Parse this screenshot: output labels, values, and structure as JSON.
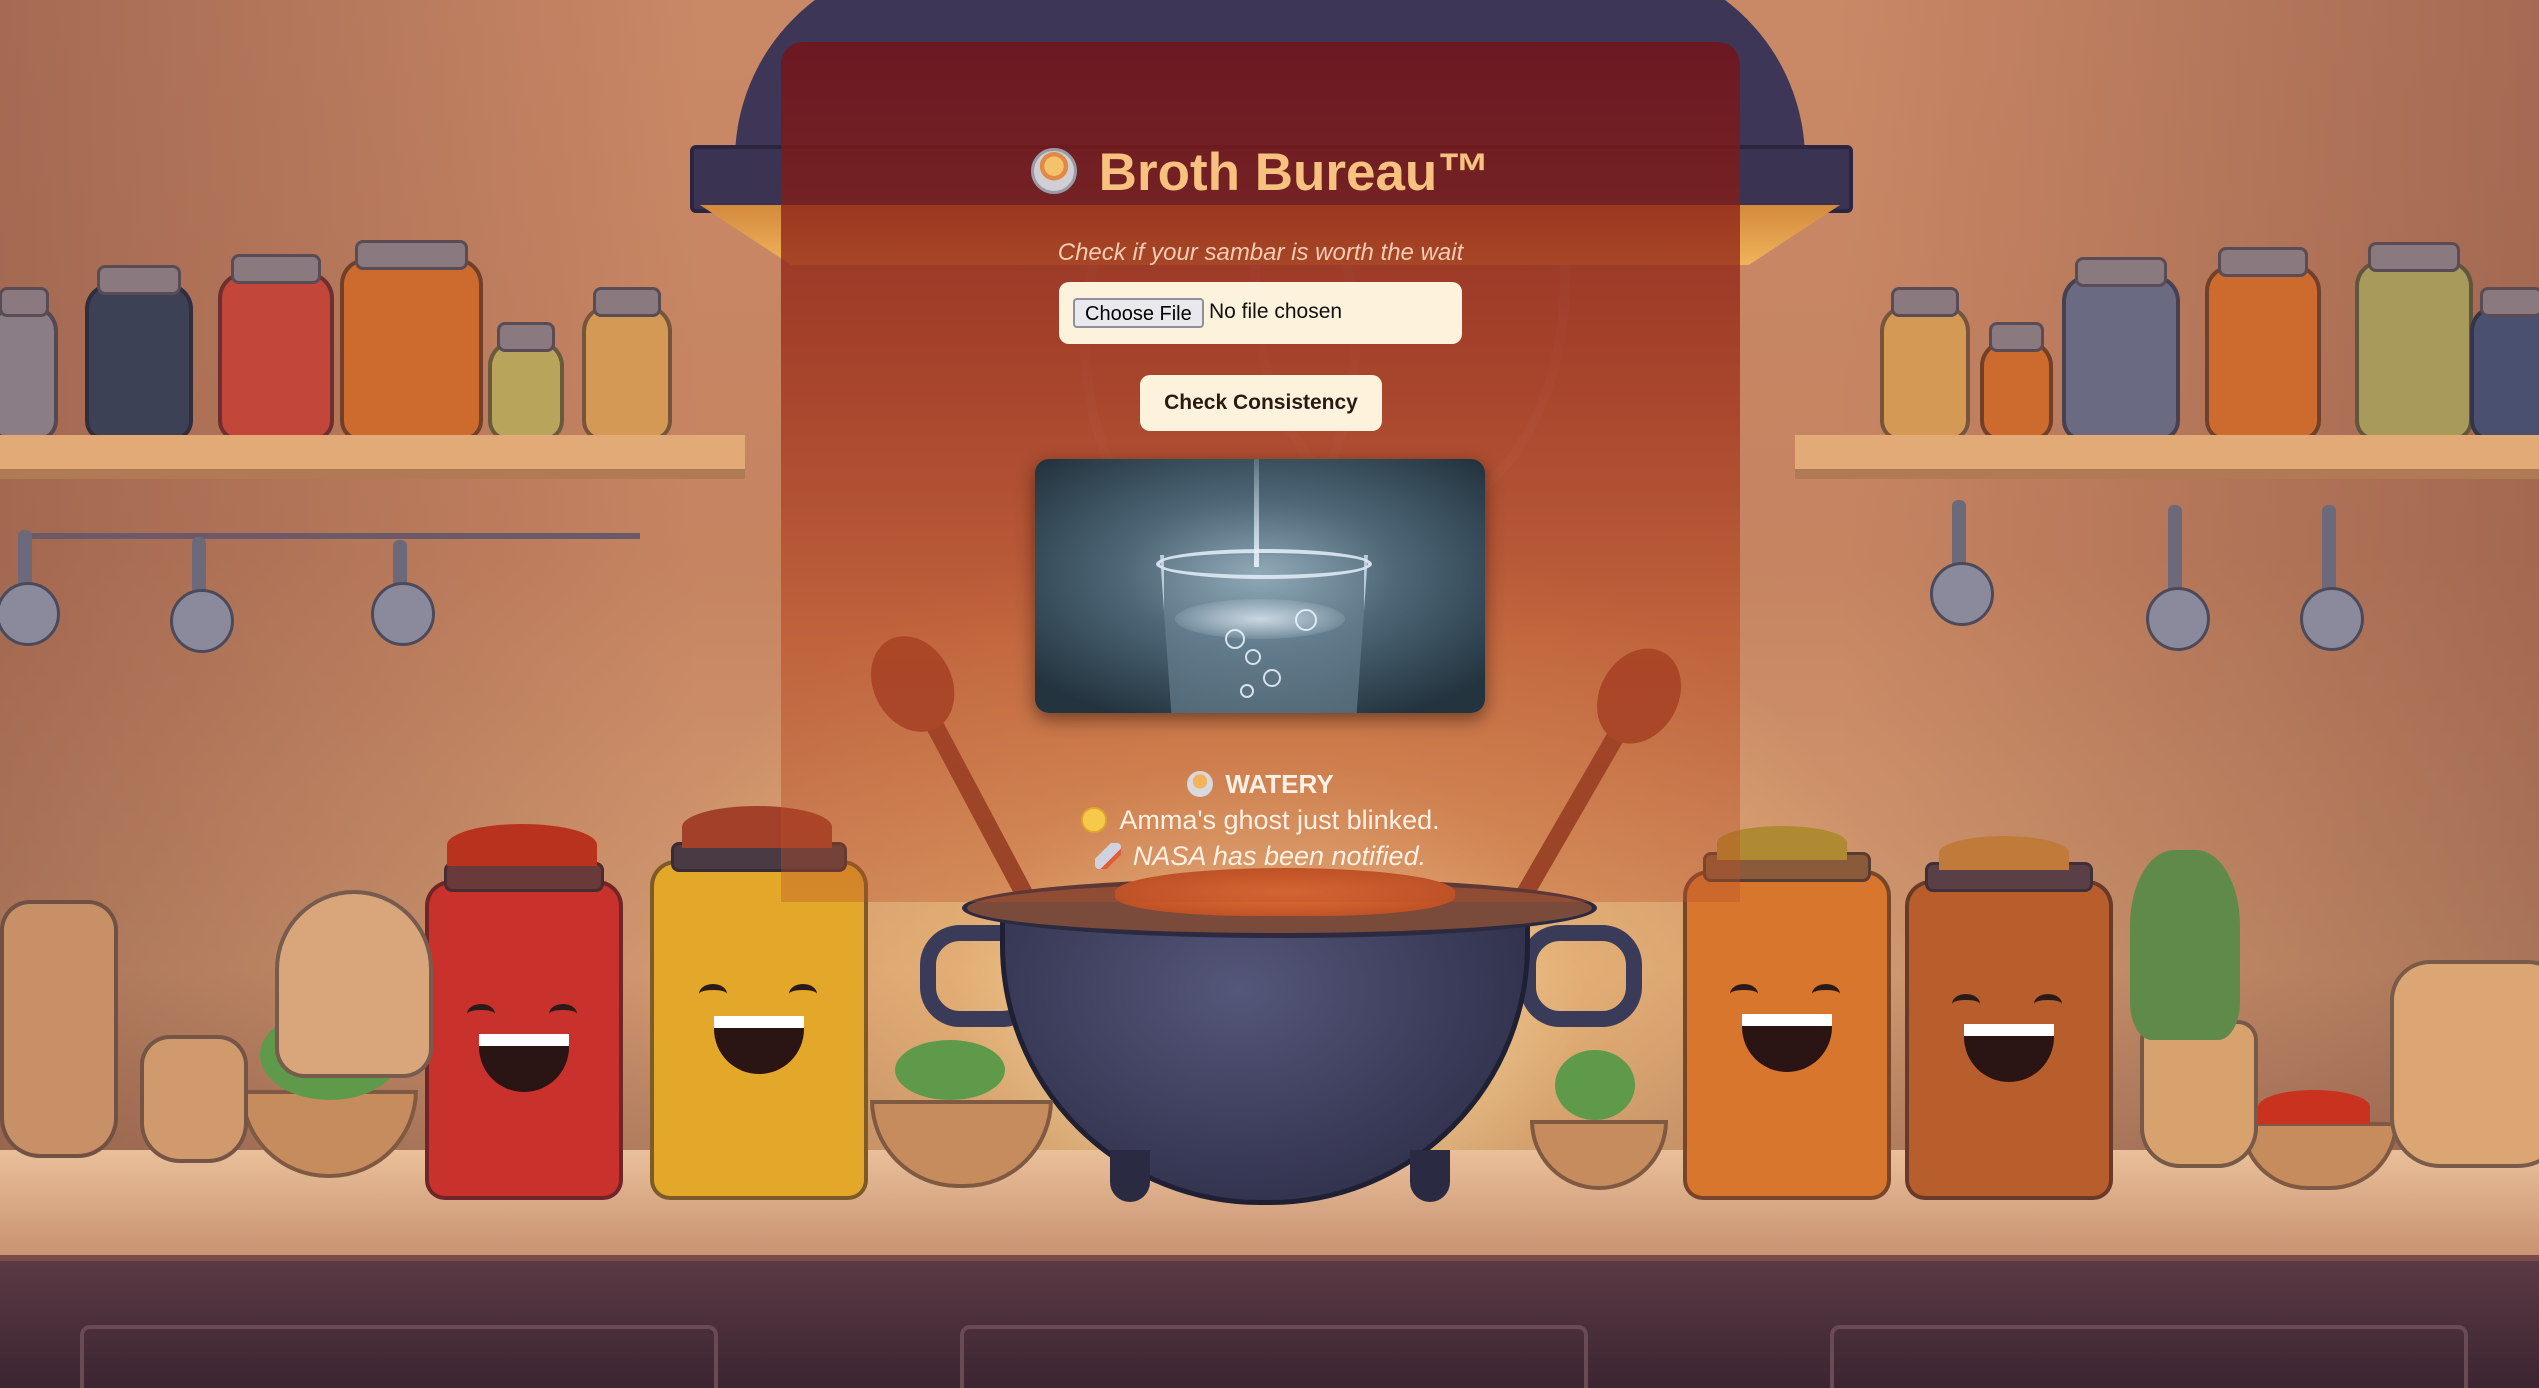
{
  "app": {
    "title": "Broth Bureau™",
    "subtitle": "Check if your sambar is worth the wait"
  },
  "upload": {
    "button_label": "Choose File",
    "status_text": "No file chosen"
  },
  "actions": {
    "check_label": "Check Consistency"
  },
  "preview": {
    "icon": "glass-of-water-image"
  },
  "result": {
    "verdict": "WATERY",
    "verdict_icon": "bowl-icon",
    "remark": "Amma's ghost just blinked.",
    "remark_icon": "crying-face-icon",
    "note": "NASA has been notified.",
    "note_icon": "rocket-icon"
  },
  "colors": {
    "title": "#f7c180",
    "card": "#7a1014",
    "button_bg": "#fdf3dc",
    "result_text": "#fdf1e6"
  }
}
